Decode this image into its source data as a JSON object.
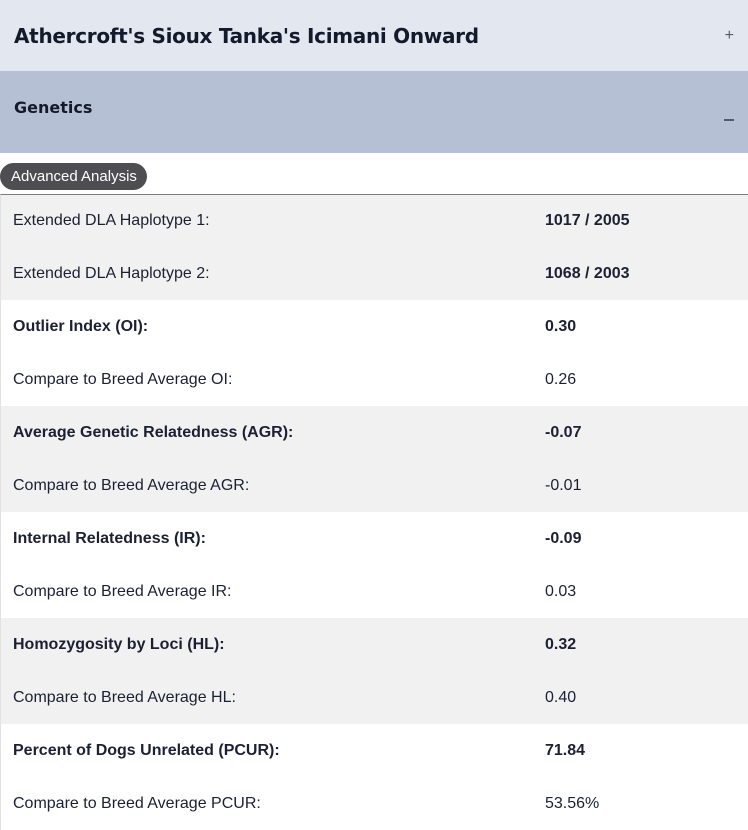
{
  "header": {
    "title": "Athercroft's Sioux Tanka's Icimani Onward",
    "expand_icon": "+"
  },
  "section": {
    "title": "Genetics"
  },
  "badge": {
    "label": "Advanced Analysis"
  },
  "rows": [
    {
      "label": "Extended DLA Haplotype 1:",
      "value": "1017 / 2005"
    },
    {
      "label": "Extended DLA Haplotype 2:",
      "value": "1068 / 2003"
    },
    {
      "label": "Outlier Index (OI):",
      "value": "0.30"
    },
    {
      "label": "Compare to Breed Average OI:",
      "value": "0.26"
    },
    {
      "label": "Average Genetic Relatedness (AGR):",
      "value": "-0.07"
    },
    {
      "label": "Compare to Breed Average AGR:",
      "value": "-0.01"
    },
    {
      "label": "Internal Relatedness (IR):",
      "value": "-0.09"
    },
    {
      "label": "Compare to Breed Average IR:",
      "value": "0.03"
    },
    {
      "label": "Homozygosity by Loci (HL):",
      "value": "0.32"
    },
    {
      "label": "Compare to Breed Average HL:",
      "value": "0.40"
    },
    {
      "label": "Percent of Dogs Unrelated (PCUR):",
      "value": "71.84"
    },
    {
      "label": "Compare to Breed Average PCUR:",
      "value": "53.56%"
    }
  ]
}
